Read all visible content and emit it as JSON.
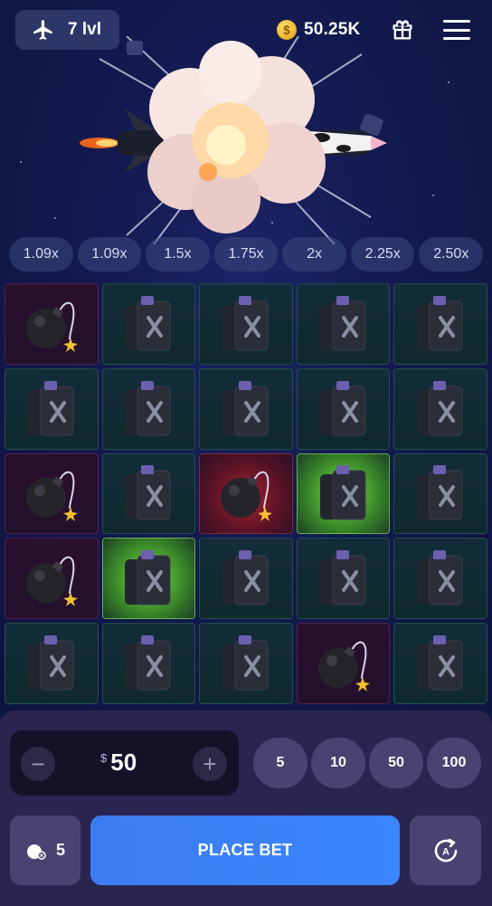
{
  "header": {
    "level": "7 lvl",
    "level_icon": "airplane-icon",
    "balance": "50.25K",
    "coin_symbol": "$",
    "gift_icon": "gift-icon",
    "menu_icon": "menu-icon"
  },
  "multipliers": [
    "1.09x",
    "1.09x",
    "1.5x",
    "1.75x",
    "2x",
    "2.25x",
    "2.50x"
  ],
  "grid": {
    "rows": [
      [
        "bomb",
        "canister",
        "canister",
        "canister",
        "canister"
      ],
      [
        "canister",
        "canister",
        "canister",
        "canister",
        "canister"
      ],
      [
        "bomb",
        "canister",
        "bomb-hit",
        "canister-picked",
        "canister"
      ],
      [
        "bomb",
        "canister-picked",
        "canister",
        "canister",
        "canister"
      ],
      [
        "canister",
        "canister",
        "canister",
        "bomb",
        "canister"
      ]
    ]
  },
  "bet": {
    "currency": "$",
    "amount": "50",
    "minus": "−",
    "plus": "+",
    "quick_amounts": [
      "5",
      "10",
      "50",
      "100"
    ]
  },
  "controls": {
    "bombs_count": "5",
    "place_bet_label": "PLACE BET",
    "auto_icon": "auto-play-icon"
  },
  "colors": {
    "background": "#0f1744",
    "panel": "#2a2450",
    "place_bet": "#3a86ff",
    "win_cell": "#7fe04a",
    "hit_cell": "#a5232f"
  }
}
